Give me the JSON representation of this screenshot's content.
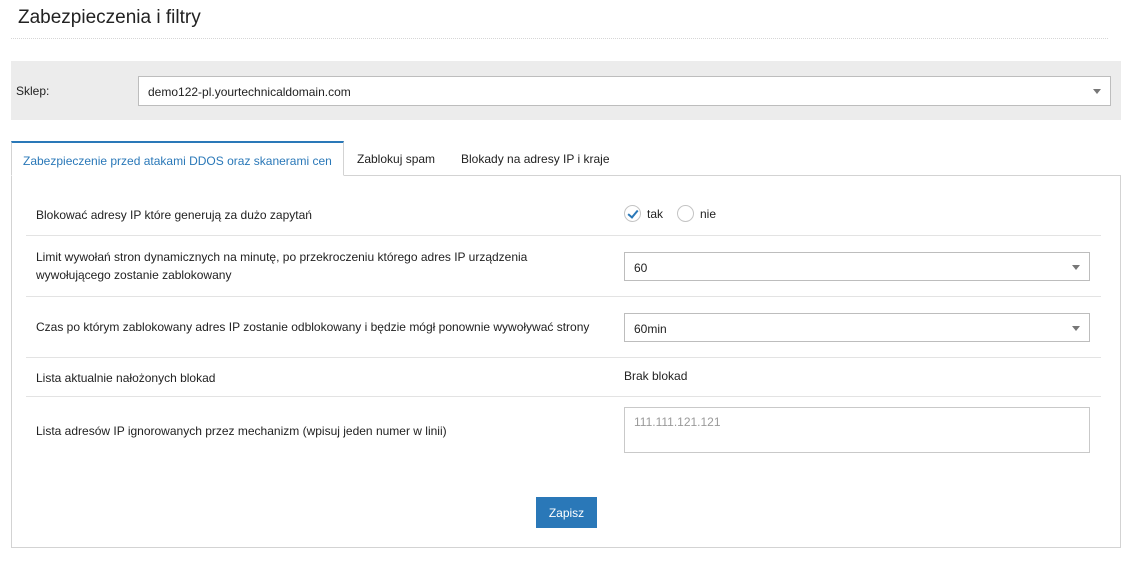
{
  "page": {
    "title": "Zabezpieczenia i filtry"
  },
  "shop": {
    "label": "Sklep:",
    "selected": "demo122-pl.yourtechnicaldomain.com"
  },
  "tabs": [
    {
      "label": "Zabezpieczenie przed atakami DDOS oraz skanerami cen",
      "active": true
    },
    {
      "label": "Zablokuj spam",
      "active": false
    },
    {
      "label": "Blokady na adresy IP i kraje",
      "active": false
    }
  ],
  "form": {
    "block_ip": {
      "label": "Blokować adresy IP które generują za dużo zapytań",
      "options": [
        {
          "label": "tak",
          "checked": true
        },
        {
          "label": "nie",
          "checked": false
        }
      ]
    },
    "limit": {
      "label_line1": "Limit wywołań stron dynamicznych na minutę, po przekroczeniu którego adres IP urządzenia",
      "label_line2": "wywołującego zostanie zablokowany",
      "selected": "60"
    },
    "unblock_time": {
      "label": "Czas po którym zablokowany adres IP zostanie odblokowany i będzie mógł ponownie wywoływać strony",
      "selected": "60min"
    },
    "current_blocks": {
      "label": "Lista aktualnie nałożonych blokad",
      "value": "Brak blokad"
    },
    "ignored_ips": {
      "label": "Lista adresów IP ignorowanych przez mechanizm (wpisuj jeden numer w linii)",
      "placeholder": "111.111.121.121"
    },
    "save_label": "Zapisz"
  },
  "colors": {
    "accent": "#2a78b8",
    "bar_bg": "#ececec"
  }
}
